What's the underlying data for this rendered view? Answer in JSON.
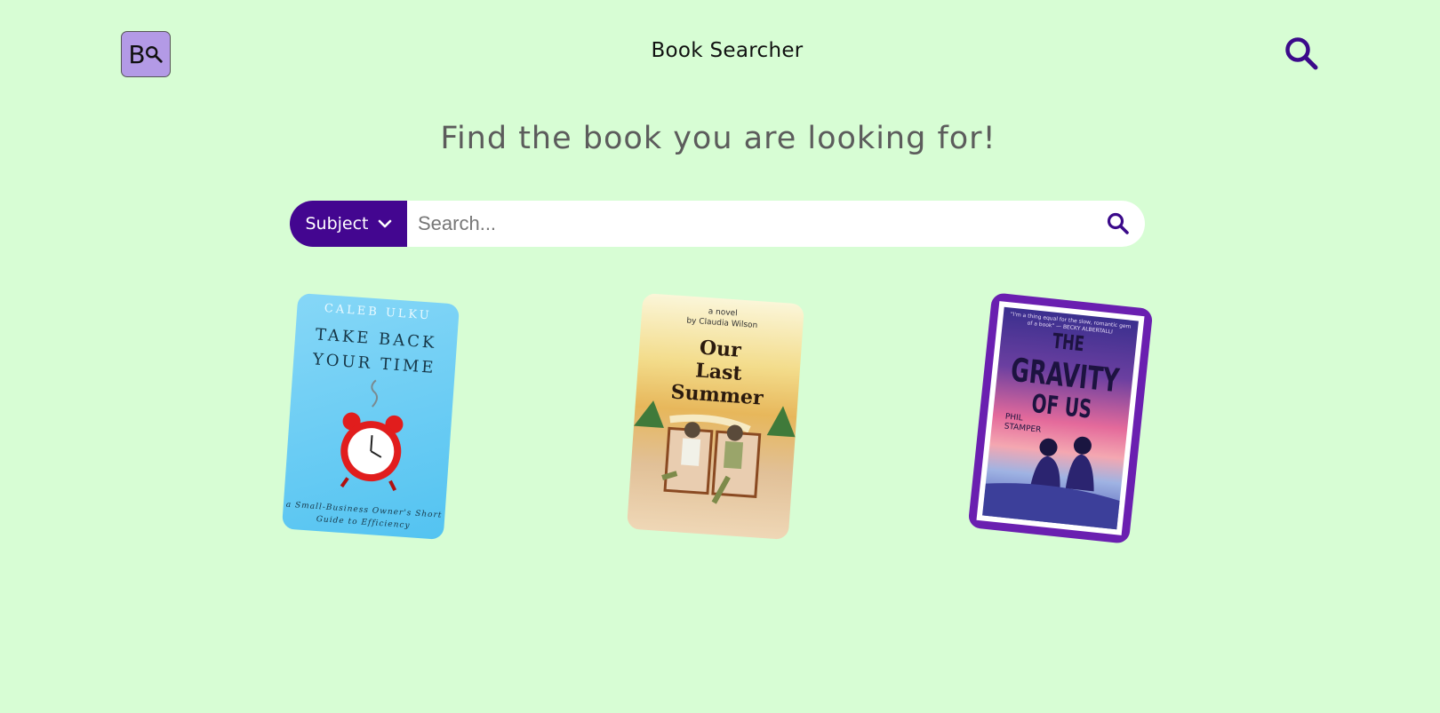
{
  "header": {
    "logo_letter": "B",
    "title": "Book Searcher"
  },
  "hero": {
    "headline": "Find the book you are looking for!"
  },
  "search": {
    "filter_label": "Subject",
    "placeholder": "Search...",
    "value": ""
  },
  "books": [
    {
      "author": "CALEB ULKU",
      "title": "TAKE BACK YOUR TIME",
      "subtitle": "a Small-Business Owner's Short Guide to Efficiency"
    },
    {
      "author_line1": "a novel",
      "author_line2": "by Claudia Wilson",
      "title_line1": "Our",
      "title_line2": "Last",
      "title_line3": "Summer"
    },
    {
      "quote": "\"I'm a thing equal for the slow, romantic gem of a book\" — BECKY ALBERTALLI",
      "title_line1": "THE",
      "title_line2": "GRAVITY",
      "title_line3": "OF US",
      "author_line1": "PHIL",
      "author_line2": "STAMPER"
    }
  ],
  "colors": {
    "background": "#d7fdd4",
    "accent": "#430690",
    "logo_bg": "#b39ae6"
  },
  "icons": {
    "top_search": "search-icon",
    "bar_search": "search-icon",
    "dropdown": "chevron-down-icon"
  }
}
